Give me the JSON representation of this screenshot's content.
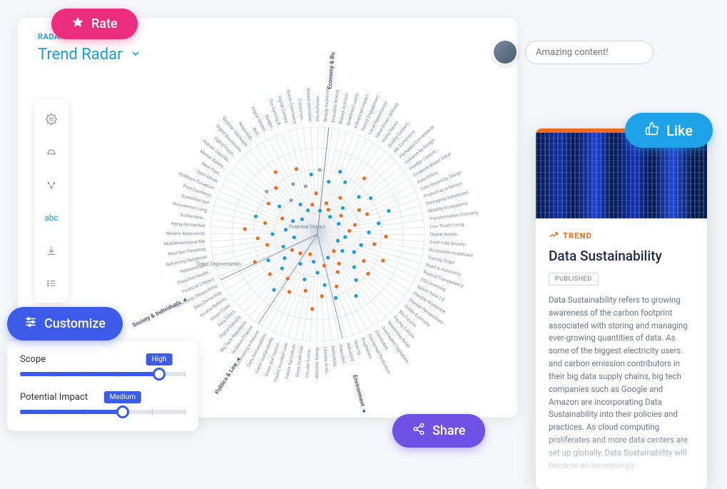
{
  "breadcrumb": "RADAR",
  "page_title": "Trend Radar",
  "rate_label": "Rate",
  "like_label": "Like",
  "share_label": "Share",
  "customize_label": "Customize",
  "comment_placeholder": "Amazing content!",
  "toolbar": {
    "abc_label": "abc"
  },
  "filters": {
    "scope": {
      "label": "Scope",
      "value_label": "High",
      "position_pct": 84
    },
    "impact": {
      "label": "Potential Impact",
      "value_label": "Medium",
      "position_pct": 62
    }
  },
  "trend_card": {
    "eyebrow": "TREND",
    "title": "Data Sustainability",
    "status": "PUBLISHED",
    "body": "Data Sustainability refers to growing awareness of the carbon footprint associated with storing and managing ever-growing quantities of data. As some of the biggest electricity users and carbon emission contributors in their big data supply chains, big tech companies such as Google and Amazon are incorporating Data Sustainability into their policies and practices. As cloud computing proliferates and more data centers are set up globally, Data Sustainability will become an increasingly"
  },
  "chart_data": {
    "type": "radar",
    "center_label": "Potential Impact",
    "subtitle": "Trend Segmentation",
    "rings": 5,
    "sectors": [
      {
        "name": "Economy & Business",
        "segments": [
          "Empathic Brands",
          "Biased Activism",
          "Redefined Luxury",
          "Influenced Impact",
          "Hybrid Engagement",
          "Local Appreciation",
          "Value Driven Delivery",
          "Home Haven",
          "Quality Content…",
          "Me Commerce",
          "Packaged Convenience",
          "Inclusive by Design",
          "Flexible Content…",
          "Evidence Based Value",
          "Easy Ethics",
          "Data Secure by Design",
          "Product-as-a-Service",
          "Packaging Substitutes",
          "Mobility Ecosystems",
          "Transformation Economy",
          "Low Touch Living",
          "Digital Assets",
          "Cash Free Society",
          "Accessible Investment",
          "Tracing Origin",
          "Road to Autonomy",
          "Radical Transparency",
          "ESG Investing",
          "Space Race 2.0",
          "Flexible Workplace",
          "Diverse Perspectives",
          "Hobby Economy",
          "Bio Futures",
          "Paying Culture",
          "Relearning Retail",
          "Overhauled Capitalism",
          "Distributed…",
          "Connected Production",
          "Prophecies…",
          "Sharing…",
          "Rebooted…"
        ]
      },
      {
        "name": "Environment",
        "segments": [
          "Rebooted…",
          "Rethinking…",
          "Climate Actio…",
          "Absolute Energy",
          "Circular Econo…",
          "Every Scale Gap",
          "Future Agriculture",
          "Plastic Avoided Lean",
          "Green and Techno…",
          "Green Sustainability",
          "Data Sustainability",
          "Automating a Greener"
        ]
      },
      {
        "name": "Politics & Law",
        "segments": [
          "Inclusive Finance",
          "Big Tech Regulation",
          "Digital Equality",
          "Data Ethics",
          "Smart Cities",
          "Income Reform",
          "Data Ownership",
          "Community Stewardship"
        ]
      },
      {
        "name": "Society & Individuals",
        "segments": [
          "Financial Literacy",
          "Proactive Health…",
          "Relationships…",
          "Reframing Residence",
          "Next Gen Parenting",
          "Multidimensional Me",
          "Modern Masculinity",
          "Aging Reinvented",
          "Sustainable…",
          "Recentered Living",
          "Quantified Self",
          "Pure Goodness",
          "Outdoors Escapism",
          "Open Minds",
          "New Psyc…",
          "Mental Balans…",
          "Human Override…",
          "Digital Focus…",
          "Digital Boundaries",
          "Modular Telehealth",
          "Responsib…",
          "Bett…",
          "Digital Shelter…",
          "Budget…",
          "The Gaming B…",
          "Digital Compa…",
          "Social Commerce",
          "Conscious…",
          "Broadcastization",
          "Pro-Activism…",
          "Beauty Inclusivity"
        ]
      }
    ],
    "sector_boundaries_deg": [
      -82,
      112,
      165,
      200,
      278
    ],
    "points": [
      {
        "a": -78,
        "r": 0.5,
        "c": "blue"
      },
      {
        "a": -74,
        "r": 0.3,
        "c": "orange"
      },
      {
        "a": -70,
        "r": 0.62,
        "c": "blue"
      },
      {
        "a": -66,
        "r": 0.25,
        "c": "orange"
      },
      {
        "a": -62,
        "r": 0.55,
        "c": "blue"
      },
      {
        "a": -58,
        "r": 0.4,
        "c": "orange"
      },
      {
        "a": -54,
        "r": 0.2,
        "c": "blue"
      },
      {
        "a": -50,
        "r": 0.68,
        "c": "orange"
      },
      {
        "a": -46,
        "r": 0.34,
        "c": "blue"
      },
      {
        "a": -42,
        "r": 0.52,
        "c": "blue"
      },
      {
        "a": -38,
        "r": 0.28,
        "c": "orange"
      },
      {
        "a": -34,
        "r": 0.6,
        "c": "blue"
      },
      {
        "a": -30,
        "r": 0.45,
        "c": "orange"
      },
      {
        "a": -26,
        "r": 0.22,
        "c": "blue"
      },
      {
        "a": -22,
        "r": 0.5,
        "c": "orange"
      },
      {
        "a": -18,
        "r": 0.7,
        "c": "blue"
      },
      {
        "a": -14,
        "r": 0.36,
        "c": "orange"
      },
      {
        "a": -10,
        "r": 0.58,
        "c": "blue"
      },
      {
        "a": -6,
        "r": 0.3,
        "c": "orange"
      },
      {
        "a": -2,
        "r": 0.48,
        "c": "blue"
      },
      {
        "a": 2,
        "r": 0.64,
        "c": "orange"
      },
      {
        "a": 6,
        "r": 0.26,
        "c": "blue"
      },
      {
        "a": 10,
        "r": 0.54,
        "c": "orange"
      },
      {
        "a": 14,
        "r": 0.42,
        "c": "blue"
      },
      {
        "a": 18,
        "r": 0.2,
        "c": "blue"
      },
      {
        "a": 22,
        "r": 0.66,
        "c": "orange"
      },
      {
        "a": 26,
        "r": 0.38,
        "c": "blue"
      },
      {
        "a": 30,
        "r": 0.5,
        "c": "orange"
      },
      {
        "a": 34,
        "r": 0.28,
        "c": "blue"
      },
      {
        "a": 38,
        "r": 0.6,
        "c": "orange"
      },
      {
        "a": 42,
        "r": 0.46,
        "c": "blue"
      },
      {
        "a": 46,
        "r": 0.22,
        "c": "orange"
      },
      {
        "a": 50,
        "r": 0.56,
        "c": "blue"
      },
      {
        "a": 54,
        "r": 0.34,
        "c": "orange"
      },
      {
        "a": 58,
        "r": 0.68,
        "c": "blue"
      },
      {
        "a": 62,
        "r": 0.4,
        "c": "orange"
      },
      {
        "a": 66,
        "r": 0.24,
        "c": "blue"
      },
      {
        "a": 70,
        "r": 0.52,
        "c": "orange"
      },
      {
        "a": 74,
        "r": 0.62,
        "c": "blue"
      },
      {
        "a": 78,
        "r": 0.3,
        "c": "orange"
      },
      {
        "a": 82,
        "r": 0.48,
        "c": "blue"
      },
      {
        "a": 86,
        "r": 0.58,
        "c": "orange"
      },
      {
        "a": 90,
        "r": 0.36,
        "c": "blue"
      },
      {
        "a": 94,
        "r": 0.7,
        "c": "orange"
      },
      {
        "a": 98,
        "r": 0.26,
        "c": "blue"
      },
      {
        "a": 102,
        "r": 0.54,
        "c": "orange"
      },
      {
        "a": 106,
        "r": 0.44,
        "c": "blue"
      },
      {
        "a": 110,
        "r": 0.2,
        "c": "orange"
      },
      {
        "a": 116,
        "r": 0.6,
        "c": "orange"
      },
      {
        "a": 120,
        "r": 0.32,
        "c": "blue"
      },
      {
        "a": 124,
        "r": 0.5,
        "c": "orange"
      },
      {
        "a": 128,
        "r": 0.66,
        "c": "blue"
      },
      {
        "a": 132,
        "r": 0.24,
        "c": "orange"
      },
      {
        "a": 136,
        "r": 0.46,
        "c": "blue"
      },
      {
        "a": 140,
        "r": 0.58,
        "c": "orange"
      },
      {
        "a": 144,
        "r": 0.38,
        "c": "blue"
      },
      {
        "a": 148,
        "r": 0.28,
        "c": "orange"
      },
      {
        "a": 152,
        "r": 0.52,
        "c": "blue"
      },
      {
        "a": 156,
        "r": 0.64,
        "c": "orange"
      },
      {
        "a": 160,
        "r": 0.34,
        "c": "blue"
      },
      {
        "a": 168,
        "r": 0.48,
        "c": "orange"
      },
      {
        "a": 172,
        "r": 0.22,
        "c": "blue"
      },
      {
        "a": 176,
        "r": 0.56,
        "c": "orange"
      },
      {
        "a": 180,
        "r": 0.42,
        "c": "blue"
      },
      {
        "a": 184,
        "r": 0.68,
        "c": "orange"
      },
      {
        "a": 188,
        "r": 0.3,
        "c": "blue"
      },
      {
        "a": 192,
        "r": 0.5,
        "c": "orange"
      },
      {
        "a": 196,
        "r": 0.6,
        "c": "blue"
      },
      {
        "a": 204,
        "r": 0.36,
        "c": "orange"
      },
      {
        "a": 208,
        "r": 0.26,
        "c": "blue"
      },
      {
        "a": 212,
        "r": 0.54,
        "c": "orange"
      },
      {
        "a": 216,
        "r": 0.44,
        "c": "blue"
      },
      {
        "a": 220,
        "r": 0.62,
        "c": "gray"
      },
      {
        "a": 224,
        "r": 0.2,
        "c": "blue"
      },
      {
        "a": 228,
        "r": 0.58,
        "c": "orange"
      },
      {
        "a": 232,
        "r": 0.4,
        "c": "gray"
      },
      {
        "a": 236,
        "r": 0.7,
        "c": "orange"
      },
      {
        "a": 240,
        "r": 0.32,
        "c": "blue"
      },
      {
        "a": 244,
        "r": 0.52,
        "c": "gray"
      },
      {
        "a": 248,
        "r": 0.24,
        "c": "blue"
      },
      {
        "a": 252,
        "r": 0.64,
        "c": "orange"
      },
      {
        "a": 256,
        "r": 0.46,
        "c": "gray"
      },
      {
        "a": 260,
        "r": 0.28,
        "c": "orange"
      },
      {
        "a": 264,
        "r": 0.56,
        "c": "blue"
      },
      {
        "a": 268,
        "r": 0.38,
        "c": "orange"
      },
      {
        "a": 272,
        "r": 0.6,
        "c": "gray"
      },
      {
        "a": 276,
        "r": 0.22,
        "c": "blue"
      }
    ]
  }
}
